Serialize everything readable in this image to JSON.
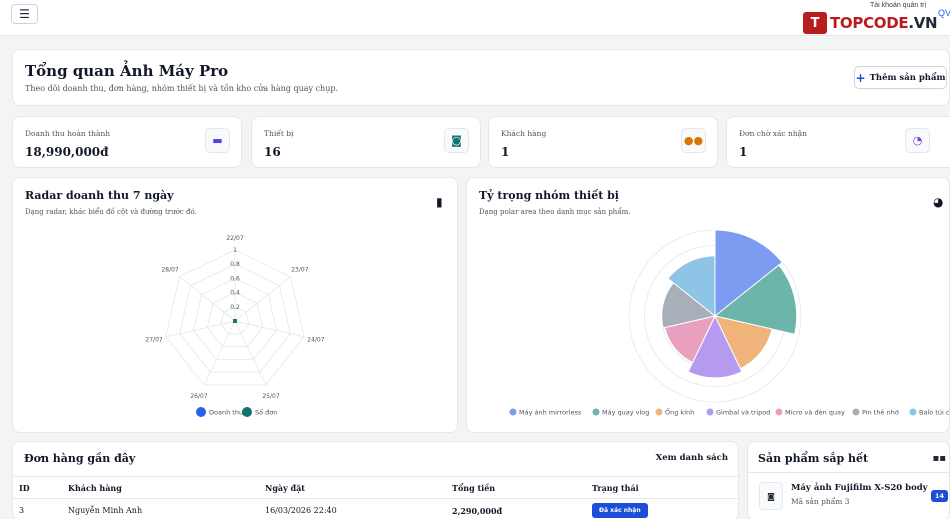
{
  "topbar": {
    "account_label": "Tài khoản quản trị",
    "account_name": "QV",
    "logo": {
      "mark": "T",
      "brand_a": "TOPCODE",
      "brand_b": ".VN"
    }
  },
  "hero": {
    "title": "Tổng quan Ảnh Máy Pro",
    "subtitle": "Theo dõi doanh thu, đơn hàng, nhóm thiết bị và tồn kho cửa hàng quay chụp.",
    "add_button": "Thêm sản phẩm",
    "add_icon": "plus-icon"
  },
  "stats": [
    {
      "label": "Doanh thu hoàn thành",
      "value": "18,990,000đ",
      "icon": "wallet-icon",
      "color": "#4f46e5"
    },
    {
      "label": "Thiết bị",
      "value": "16",
      "icon": "camera-icon",
      "color": "#0f766e"
    },
    {
      "label": "Khách hàng",
      "value": "1",
      "icon": "users-icon",
      "color": "#d97706"
    },
    {
      "label": "Đơn chờ xác nhận",
      "value": "1",
      "icon": "clock-icon",
      "color": "#7c3aed"
    }
  ],
  "radar": {
    "title": "Radar doanh thu 7 ngày",
    "subtitle": "Dạng radar, khác biểu đồ cột và đường trước đó.",
    "icon": "bar-chart-icon"
  },
  "polar": {
    "title": "Tỷ trọng nhóm thiết bị",
    "subtitle": "Dạng polar area theo danh mục sản phẩm.",
    "icon": "pie-chart-icon"
  },
  "chart_data": [
    {
      "type": "radar",
      "categories": [
        "22/07",
        "23/07",
        "24/07",
        "25/07",
        "26/07",
        "27/07",
        "28/07"
      ],
      "ticks": [
        "0,2",
        "0,4",
        "0,6",
        "0,8",
        "1"
      ],
      "rlim": [
        0,
        1
      ],
      "series": [
        {
          "name": "Doanh thu",
          "values": [
            0,
            0,
            0,
            0,
            0,
            0,
            0
          ],
          "color": "#2563eb"
        },
        {
          "name": "Số đơn",
          "values": [
            0,
            0,
            0,
            0,
            0,
            0,
            0
          ],
          "color": "#0f766e"
        }
      ],
      "legend": "bottom"
    },
    {
      "type": "polar_area",
      "categories": [
        "Máy ảnh mirrorless",
        "Máy quay vlog",
        "Ống kính",
        "Gimbal và tripod",
        "Micro và đèn quay",
        "Pin thẻ nhớ",
        "Balo túi chống ẩm"
      ],
      "values": [
        1.0,
        0.95,
        0.68,
        0.72,
        0.6,
        0.62,
        0.7
      ],
      "colors": [
        "#7b9cf0",
        "#6bb5aa",
        "#f0b47a",
        "#b59af0",
        "#e8a0be",
        "#a9afb8",
        "#8ec5e6"
      ],
      "legend": "bottom"
    }
  ],
  "orders": {
    "title": "Đơn hàng gần đây",
    "link": "Xem danh sách",
    "columns": [
      "ID",
      "Khách hàng",
      "Ngày đặt",
      "Tổng tiền",
      "Trạng thái"
    ],
    "rows": [
      {
        "id": "3",
        "customer": "Nguyễn Minh Anh",
        "date": "16/03/2026 22:40",
        "total": "2,290,000đ",
        "status": "Đã xác nhận"
      }
    ]
  },
  "lowstock": {
    "title": "Sản phẩm sắp hết",
    "icon": "boxes-icon",
    "items": [
      {
        "name": "Máy ảnh Fujifilm X-S20 body",
        "sub": "Mã sản phẩm 3",
        "count": "14"
      }
    ]
  }
}
